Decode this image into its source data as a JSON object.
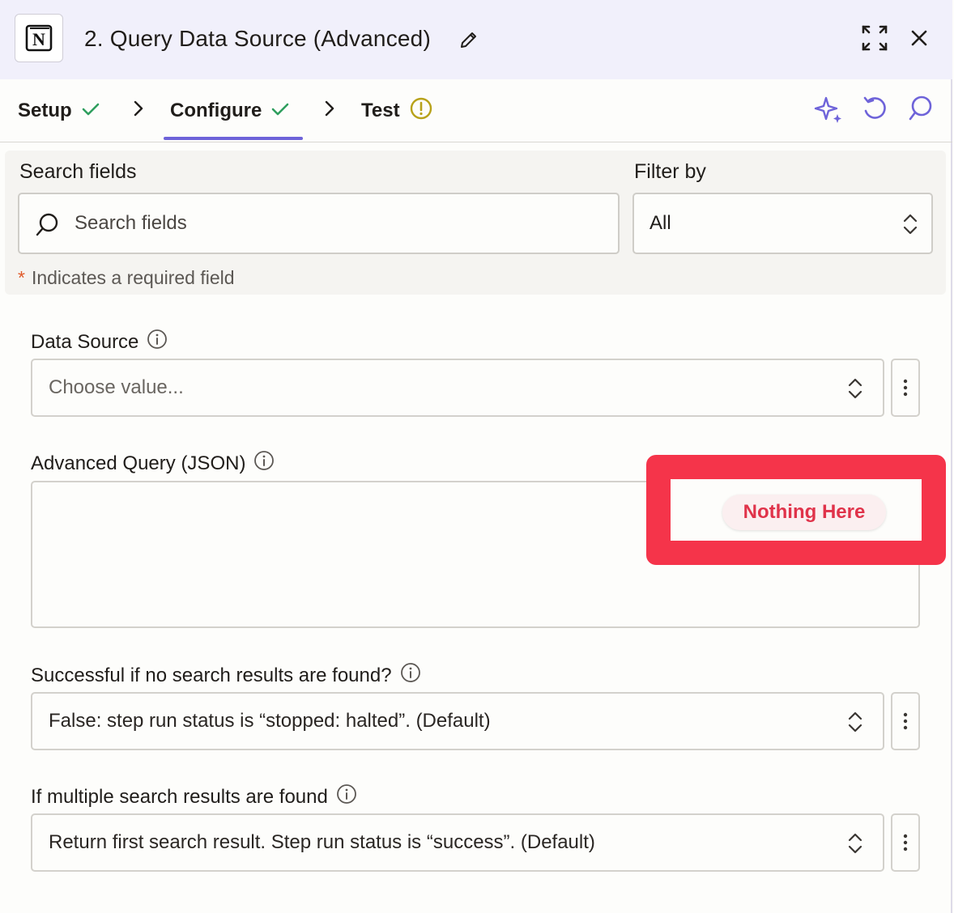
{
  "header": {
    "title": "2. Query Data Source (Advanced)",
    "app_icon_letter": "N"
  },
  "tabs": [
    {
      "label": "Setup",
      "status": "check"
    },
    {
      "label": "Configure",
      "status": "check",
      "active": true
    },
    {
      "label": "Test",
      "status": "warning"
    }
  ],
  "search": {
    "label": "Search fields",
    "placeholder": "Search fields"
  },
  "filter": {
    "label": "Filter by",
    "value": "All"
  },
  "required_note": {
    "star": "*",
    "text": "Indicates a required field"
  },
  "fields": {
    "data_source": {
      "label": "Data Source",
      "placeholder": "Choose value..."
    },
    "advanced_query": {
      "label": "Advanced Query (JSON)",
      "badge": "Nothing Here"
    },
    "no_results": {
      "label": "Successful if no search results are found?",
      "value": "False: step run status is “stopped: halted”. (Default)"
    },
    "multiple_results": {
      "label": "If multiple search results are found",
      "value": "Return first search result. Step run status is “success”. (Default)"
    }
  },
  "colors": {
    "accent": "#6e63d9",
    "check": "#2f9e5e",
    "warning": "#b8a21a",
    "highlight": "#f5344a"
  }
}
